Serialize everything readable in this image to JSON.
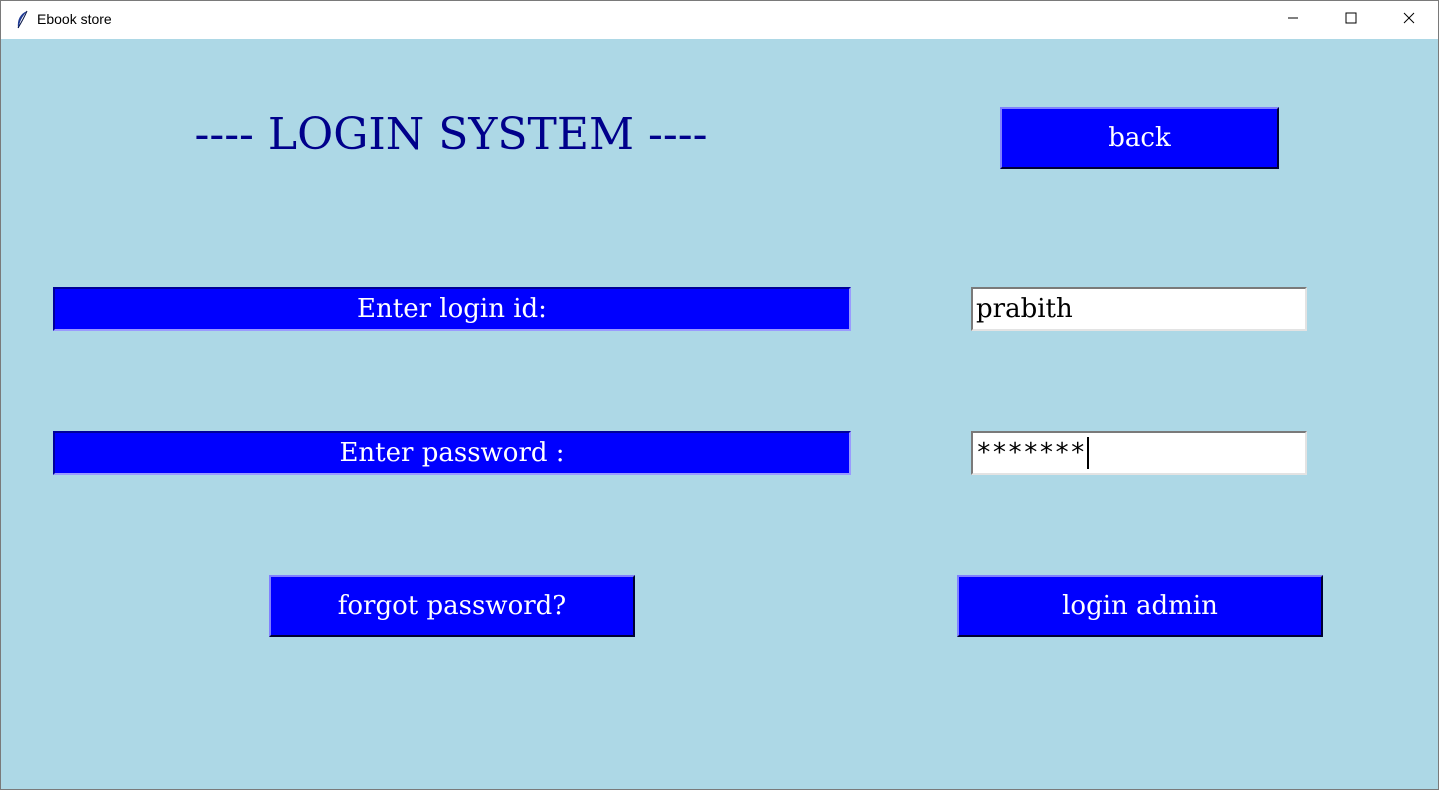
{
  "window": {
    "title": "Ebook store",
    "app_icon": "feather-icon",
    "controls": [
      "minimize-icon",
      "maximize-icon",
      "close-icon"
    ]
  },
  "heading": "---- LOGIN SYSTEM ----",
  "back_button": "back",
  "login_id": {
    "label": "Enter login id:",
    "value": "prabith"
  },
  "password": {
    "label": "Enter password :",
    "value": "*******"
  },
  "forgot_button": "forgot password?",
  "admin_button": "login admin",
  "colors": {
    "background": "#add8e6",
    "button": "#0000ff",
    "button_text": "#ffffff",
    "heading": "#00008b"
  }
}
